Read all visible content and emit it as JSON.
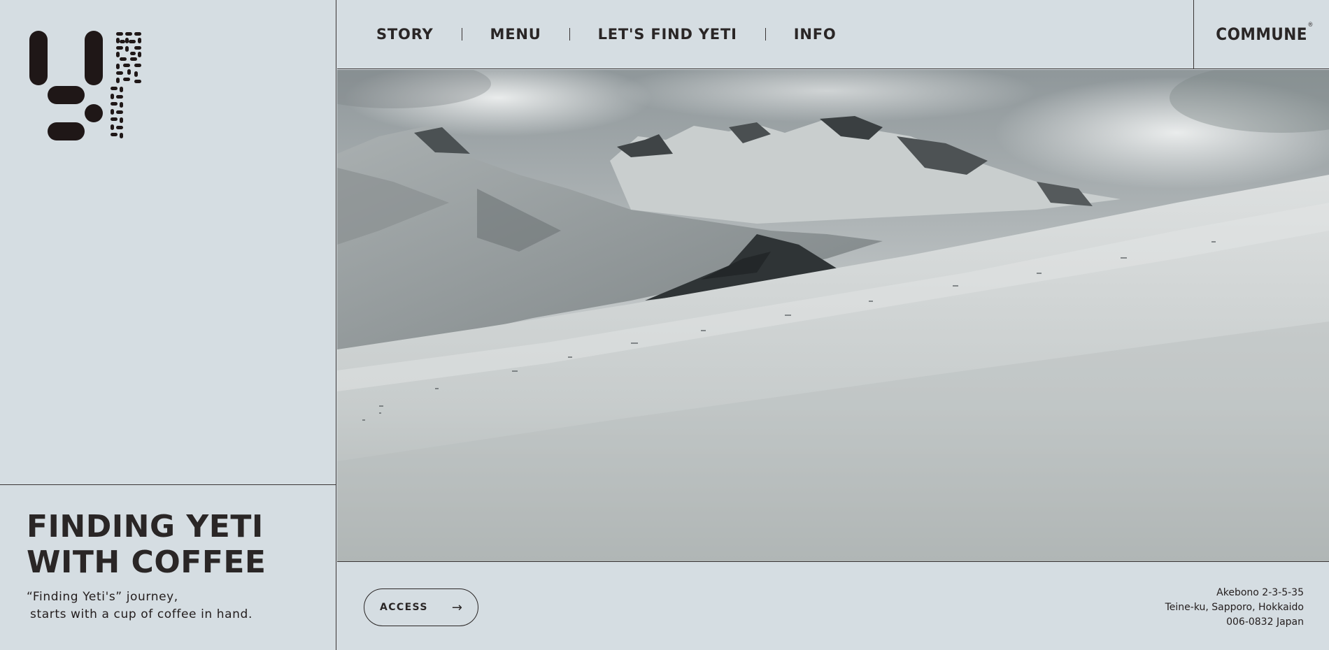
{
  "brand": {
    "name": "COMMUNE",
    "registered_mark": "®"
  },
  "nav": {
    "items": [
      {
        "label": "STORY"
      },
      {
        "label": "MENU"
      },
      {
        "label": "LET'S FIND YETI"
      },
      {
        "label": "INFO"
      }
    ]
  },
  "logo": {
    "icon": "yeti-coffee-logo-icon",
    "vertical_text": "yeti coffee"
  },
  "hero": {
    "title_line1": "FINDING YETI",
    "title_line2": "WITH COFFEE",
    "tagline_line1": "“Finding Yeti's” journey,",
    "tagline_line2": "starts with a cup of coffee in hand.",
    "image_subject": "snow-mountain-landscape"
  },
  "access": {
    "label": "ACCESS",
    "icon": "arrow-right-icon"
  },
  "address": {
    "line1": "Akebono 2-3-5-35",
    "line2": "Teine-ku, Sapporo, Hokkaido",
    "line3": "006-0832 Japan"
  },
  "colors": {
    "background": "#d5dde2",
    "text": "#231d1d",
    "border": "#3a3535"
  }
}
